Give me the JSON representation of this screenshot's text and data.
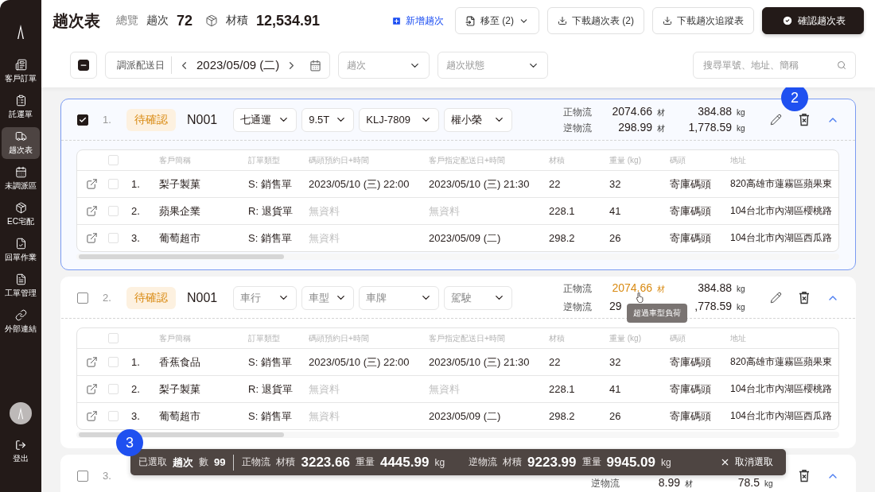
{
  "sidebar": {
    "items": [
      {
        "label": "客戶訂單",
        "selected": false
      },
      {
        "label": "託運單",
        "selected": false
      },
      {
        "label": "趟次表",
        "selected": true
      },
      {
        "label": "未調派區",
        "selected": false
      },
      {
        "label": "EC宅配",
        "selected": false
      },
      {
        "label": "回單作業",
        "selected": false
      },
      {
        "label": "工單管理",
        "selected": false
      },
      {
        "label": "外部連結",
        "selected": false
      }
    ],
    "logout": "登出"
  },
  "header": {
    "title": "趟次表",
    "overview_label": "總覽",
    "trips_label": "趟次",
    "trips_count": "72",
    "volume_label": "材積",
    "volume_total": "12,534.91",
    "add_link": "新增趟次",
    "move_button": "移至 (2)",
    "download_button": "下載趟次表 (2)",
    "download_tracking_button": "下載趟次追蹤表",
    "confirm_button": "確認趟次表"
  },
  "filters": {
    "select_all_partial": true,
    "date_label": "調派配送日",
    "date": "2023/05/09 (二)",
    "trip_select": {
      "placeholder": "趟次"
    },
    "status_select": {
      "placeholder": "趟次狀態"
    },
    "search": {
      "placeholder": "搜尋單號、地址、簡稱"
    }
  },
  "trips": [
    {
      "checked": true,
      "selected": true,
      "expanded": true,
      "index": "1.",
      "status": "待確認",
      "code": "N001",
      "marker": "2",
      "carrier": {
        "value": "七通運"
      },
      "truck_type": {
        "value": "9.5T"
      },
      "plate": {
        "value": "KLJ-7809"
      },
      "driver": {
        "value": "權小榮"
      },
      "forward": {
        "label": "正物流",
        "volume": "2074.66",
        "volume_unit": "材",
        "weight": "384.88",
        "weight_unit": "kg",
        "over_limit": false
      },
      "reverse": {
        "label": "逆物流",
        "volume": "298.99",
        "volume_unit": "材",
        "weight": "1,778.59",
        "weight_unit": "kg",
        "over_limit": false
      },
      "columns": [
        "客戶簡稱",
        "訂單類型",
        "碼頭預約日+時間",
        "客戶指定配送日+時間",
        "材積",
        "重量 (kg)",
        "碼頭",
        "地址"
      ],
      "orders": [
        {
          "checked": false,
          "index": "1.",
          "customer": "梨子製菓",
          "type": "S: 銷售單",
          "dock_time": {
            "text": "2023/05/10 (三) 22:00",
            "muted": false
          },
          "delivery_time": {
            "text": "2023/05/10 (三) 21:30",
            "muted": false
          },
          "volume": "22",
          "weight": "32",
          "dock": "寄庫碼頭",
          "address": "820高雄市蓮霧區蘋果東"
        },
        {
          "checked": false,
          "index": "2.",
          "customer": "蘋果企業",
          "type": "R: 退貨單",
          "dock_time": {
            "text": "無資料",
            "muted": true
          },
          "delivery_time": {
            "text": "無資料",
            "muted": true
          },
          "volume": "228.1",
          "weight": "41",
          "dock": "寄庫碼頭",
          "address": "104台北市內湖區櫻桃路"
        },
        {
          "checked": false,
          "index": "3.",
          "customer": "葡萄超市",
          "type": "S: 銷售單",
          "dock_time": {
            "text": "無資料",
            "muted": true
          },
          "delivery_time": {
            "text": "2023/05/09 (二)",
            "muted": false
          },
          "volume": "298.2",
          "weight": "26",
          "dock": "寄庫碼頭",
          "address": "104台北市內湖區西瓜路"
        }
      ]
    },
    {
      "checked": false,
      "selected": false,
      "expanded": true,
      "index": "2.",
      "status": "待確認",
      "code": "N001",
      "tooltip": "超過車型負荷",
      "carrier": {
        "placeholder": "車行"
      },
      "truck_type": {
        "placeholder": "車型"
      },
      "plate": {
        "placeholder": "車牌"
      },
      "driver": {
        "placeholder": "駕駛"
      },
      "forward": {
        "label": "正物流",
        "volume": "2074.66",
        "volume_unit": "材",
        "weight": "384.88",
        "weight_unit": "kg",
        "over_limit": true
      },
      "reverse": {
        "label": "逆物流",
        "volume": "29",
        "weight": ",778.59",
        "weight_unit": "kg",
        "over_limit": false
      },
      "columns": [
        "客戶簡稱",
        "訂單類型",
        "碼頭預約日+時間",
        "客戶指定配送日+時間",
        "材積",
        "重量 (kg)",
        "碼頭",
        "地址"
      ],
      "orders": [
        {
          "checked": false,
          "index": "1.",
          "customer": "香蕉食品",
          "type": "S: 銷售單",
          "dock_time": {
            "text": "2023/05/10 (三) 22:00",
            "muted": false
          },
          "delivery_time": {
            "text": "2023/05/10 (三) 21:30",
            "muted": false
          },
          "volume": "22",
          "weight": "32",
          "dock": "寄庫碼頭",
          "address": "820高雄市蓮霧區蘋果東"
        },
        {
          "checked": false,
          "index": "2.",
          "customer": "梨子製菓",
          "type": "R: 退貨單",
          "dock_time": {
            "text": "無資料",
            "muted": true
          },
          "delivery_time": {
            "text": "無資料",
            "muted": true
          },
          "volume": "228.1",
          "weight": "41",
          "dock": "寄庫碼頭",
          "address": "104台北市內湖區櫻桃路"
        },
        {
          "checked": false,
          "index": "3.",
          "customer": "葡萄超市",
          "type": "S: 銷售單",
          "dock_time": {
            "text": "無資料",
            "muted": true
          },
          "delivery_time": {
            "text": "2023/05/09 (二)",
            "muted": false
          },
          "volume": "298.2",
          "weight": "26",
          "dock": "寄庫碼頭",
          "address": "104台北市內湖區西瓜路"
        }
      ]
    },
    {
      "checked": false,
      "selected": false,
      "expanded": true,
      "index": "3.",
      "reverse": {
        "label": "逆物流",
        "volume": "8.99",
        "volume_unit": "材",
        "weight": "78.5",
        "weight_unit": "kg",
        "over_limit": false
      }
    }
  ],
  "selection_bar": {
    "marker": "3",
    "selected_label": "已選取",
    "trips_label": "趟次",
    "count_label": "數",
    "count": "99",
    "forward": {
      "label": "正物流",
      "volume_label": "材積",
      "volume": "3223.66",
      "weight_label": "重量",
      "weight": "4445.99",
      "unit": "kg"
    },
    "reverse": {
      "label": "逆物流",
      "volume_label": "材積",
      "volume": "9223.99",
      "weight_label": "重量",
      "weight": "9945.09",
      "unit": "kg"
    },
    "cancel": "取消選取"
  }
}
